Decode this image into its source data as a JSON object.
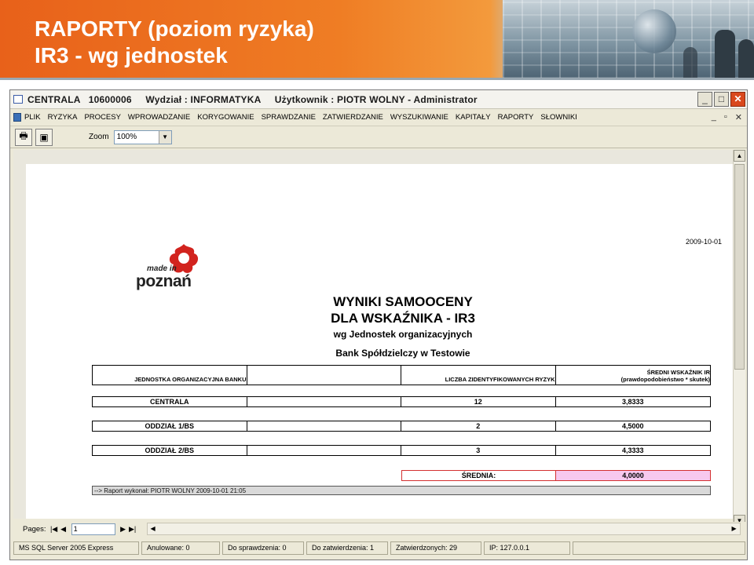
{
  "slide": {
    "title_line1": "RAPORTY (poziom ryzyka)",
    "title_line2": "IR3 - wg jednostek"
  },
  "window": {
    "title": "CENTRALA   10600006     Wydział : INFORMATYKA     Użytkownik : PIOTR WOLNY - Administrator",
    "minimize": "_",
    "maximize": "□",
    "close": "✕"
  },
  "menu": {
    "items": [
      "PLIK",
      "RYZYKA",
      "PROCESY",
      "WPROWADZANIE",
      "KORYGOWANIE",
      "SPRAWDZANIE",
      "ZATWIERDZANIE",
      "WYSZUKIWANIE",
      "KAPITAŁY",
      "RAPORTY",
      "SŁOWNIKI"
    ],
    "mdi": [
      "_",
      "▫",
      "✕"
    ]
  },
  "toolbar": {
    "zoom_label": "Zoom",
    "zoom_value": "100%"
  },
  "report": {
    "date": "2009-10-01",
    "logo_line1": "made in",
    "logo_line2": "poznań",
    "heading1": "WYNIKI SAMOOCENY",
    "heading2": "DLA WSKAŹNIKA - IR3",
    "heading3": "wg Jednostek organizacyjnych",
    "heading4": "Bank Spółdzielczy w Testowie",
    "columns": {
      "col1": "JEDNOSTKA ORGANIZACYJNA BANKU",
      "col2": "",
      "col3": "LICZBA ZIDENTYFIKOWANYCH RYZYK",
      "col4_line1": "ŚREDNI WSKAŹNIK IR",
      "col4_line2": "(prawdopodobieństwo * skutek)"
    },
    "rows": [
      {
        "unit": "CENTRALA",
        "blank": "",
        "count": "12",
        "avg": "3,8333"
      },
      {
        "unit": "ODDZIAŁ 1/BS",
        "blank": "",
        "count": "2",
        "avg": "4,5000"
      },
      {
        "unit": "ODDZIAŁ 2/BS",
        "blank": "",
        "count": "3",
        "avg": "4,3333"
      }
    ],
    "avg_label": "ŚREDNIA:",
    "avg_value": "4,0000",
    "footer": "--> Raport wykonał: PIOTR WOLNY 2009-10-01 21:05"
  },
  "nav": {
    "pages_label": "Pages:",
    "page_value": "1"
  },
  "status": {
    "items": [
      "MS SQL Server 2005 Express",
      "Anulowane: 0",
      "Do sprawdzenia: 0",
      "Do zatwierdzenia: 1",
      "Zatwierdzonych: 29",
      "IP: 127.0.0.1"
    ]
  }
}
